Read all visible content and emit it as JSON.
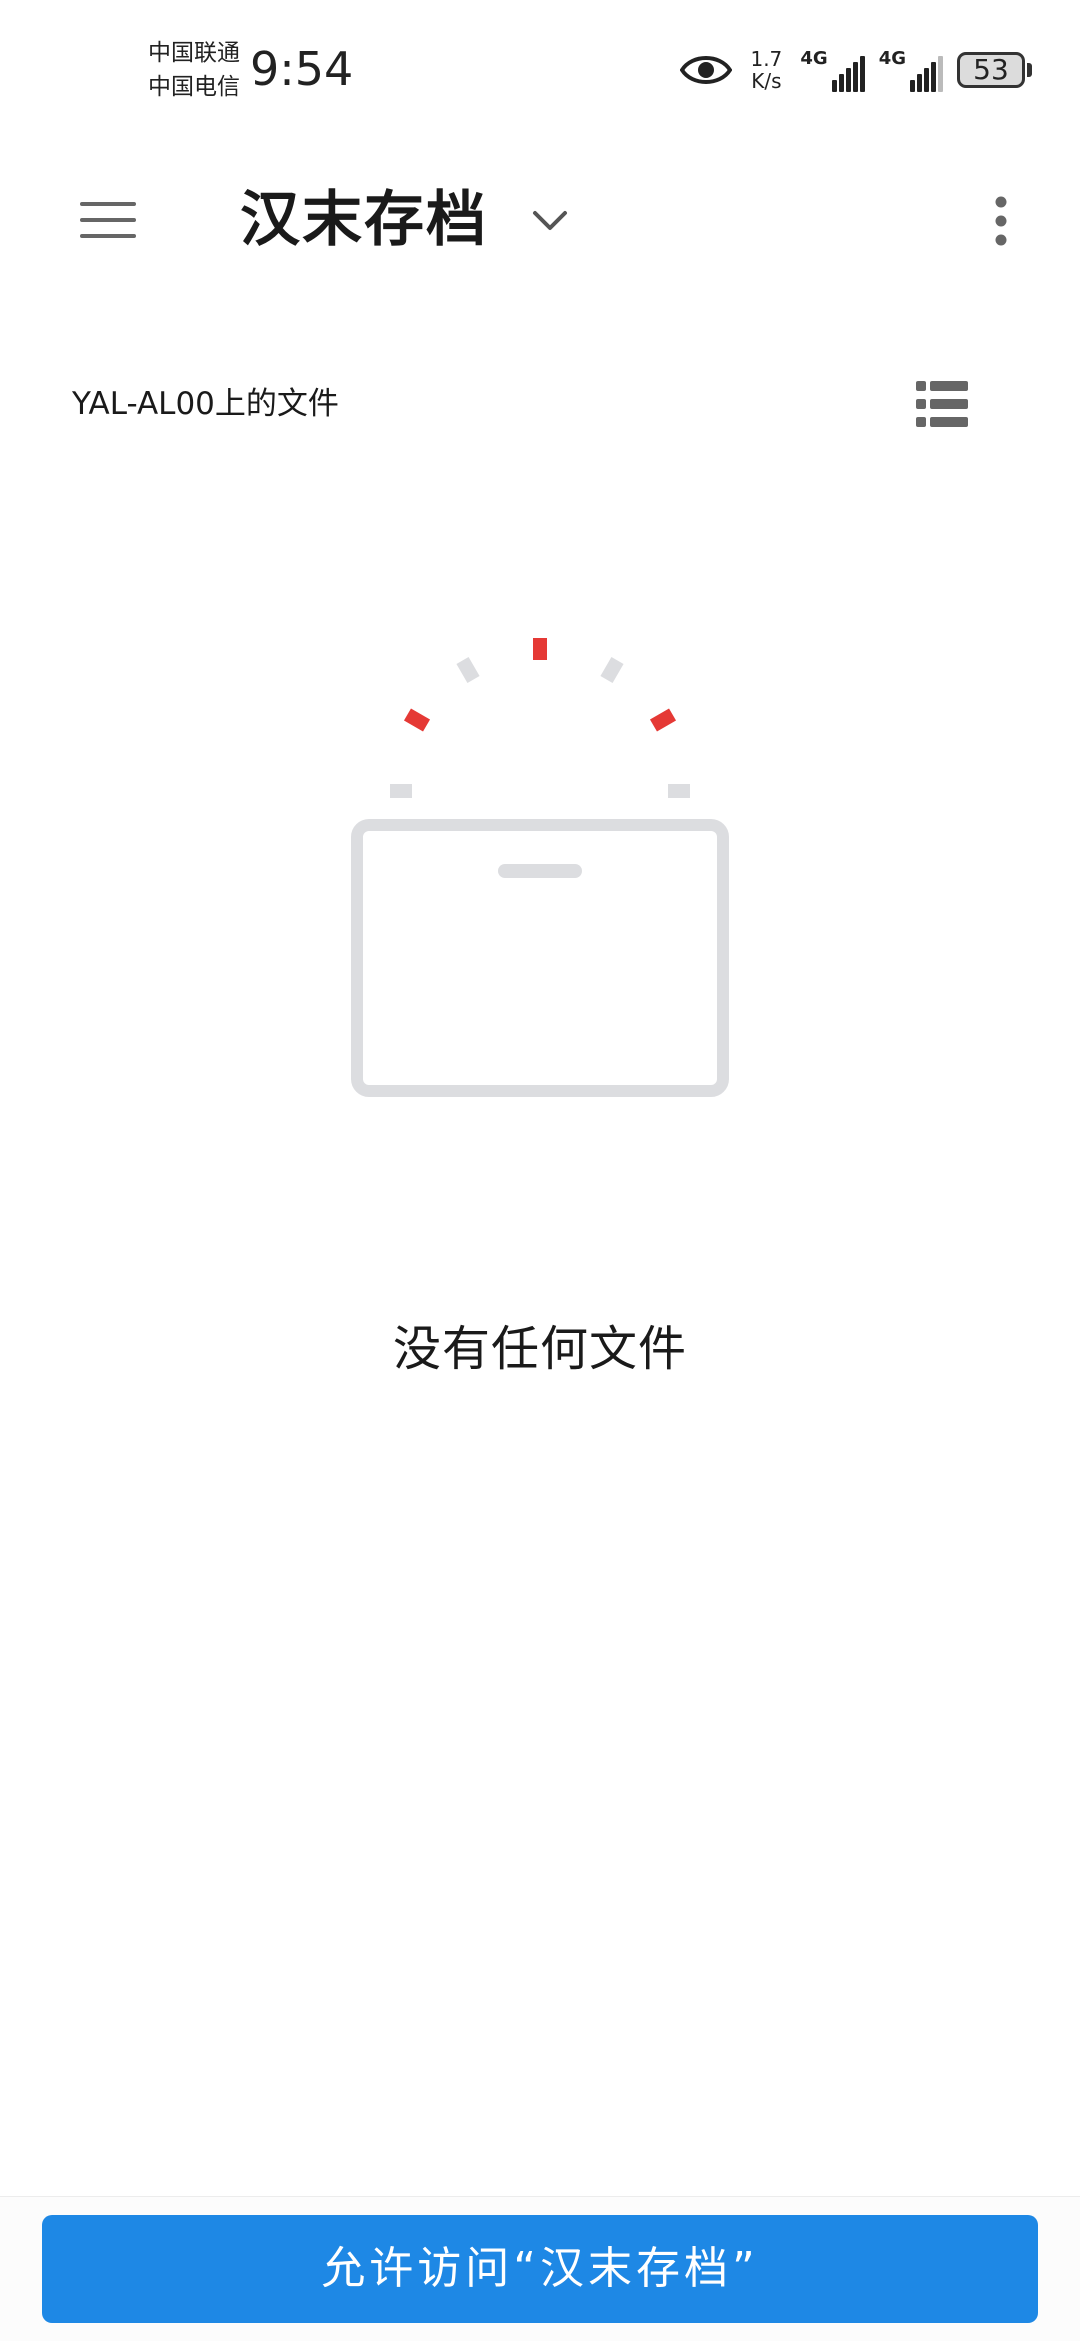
{
  "status_bar": {
    "carrier_1": "中国联通",
    "carrier_2": "中国电信",
    "time": "9:54",
    "net_speed_value": "1.7",
    "net_speed_unit": "K/s",
    "signal_1_label": "4G",
    "signal_2_label": "4G",
    "battery_level": "53"
  },
  "app_bar": {
    "title": "汉末存档",
    "menu_icon": "hamburger-menu-icon",
    "dropdown_icon": "chevron-down-icon",
    "more_icon": "more-vertical-icon"
  },
  "section": {
    "title": "YAL-AL00上的文件",
    "view_icon": "list-view-icon"
  },
  "empty_state": {
    "message": "没有任何文件",
    "illustration_icon": "empty-folder-icon",
    "colors": {
      "accent": "#e53935",
      "neutral": "#dcdde0"
    }
  },
  "bottom": {
    "allow_button_label": "允许访问“汉末存档”",
    "button_color": "#1e88e5"
  }
}
